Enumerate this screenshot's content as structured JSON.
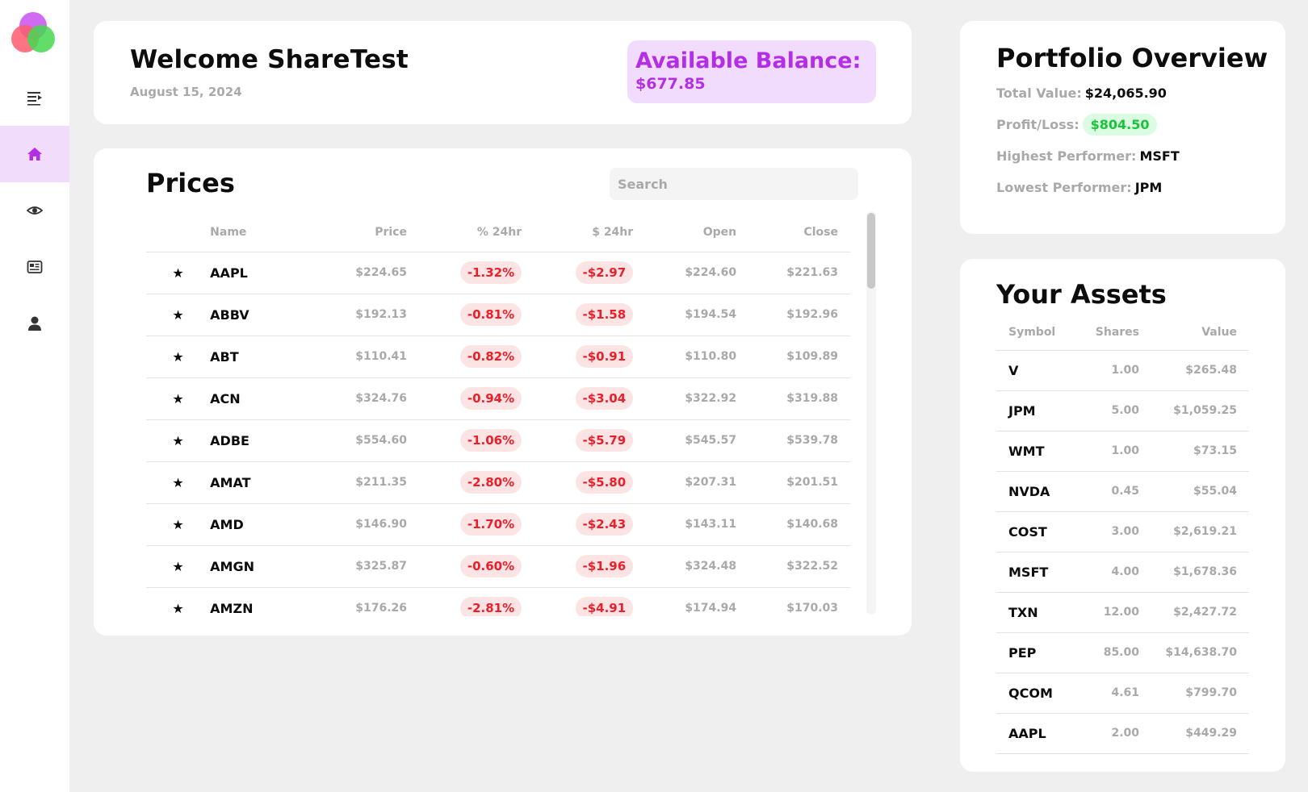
{
  "colors": {
    "accent": "#b42ee8",
    "accent_bg": "#f2dcfd",
    "negative": "#ea1f2a",
    "negative_bg": "#fde4e4",
    "positive": "#1ac43a",
    "positive_bg": "#dcfbe3"
  },
  "sidebar": {
    "items": [
      {
        "icon": "menu-icon",
        "active": false
      },
      {
        "icon": "home-icon",
        "active": true
      },
      {
        "icon": "eye-icon",
        "active": false
      },
      {
        "icon": "news-icon",
        "active": false
      },
      {
        "icon": "user-icon",
        "active": false
      }
    ]
  },
  "welcome": {
    "title": "Welcome ShareTest",
    "date": "August 15, 2024",
    "balance_label": "Available Balance:",
    "balance_value": "$677.85"
  },
  "prices": {
    "title": "Prices",
    "search_placeholder": "Search",
    "columns": [
      "Name",
      "Price",
      "% 24hr",
      "$ 24hr",
      "Open",
      "Close"
    ],
    "rows": [
      {
        "star": "★",
        "name": "AAPL",
        "price": "$224.65",
        "pct": "-1.32%",
        "chg": "-$2.97",
        "open": "$224.60",
        "close": "$221.63"
      },
      {
        "star": "★",
        "name": "ABBV",
        "price": "$192.13",
        "pct": "-0.81%",
        "chg": "-$1.58",
        "open": "$194.54",
        "close": "$192.96"
      },
      {
        "star": "★",
        "name": "ABT",
        "price": "$110.41",
        "pct": "-0.82%",
        "chg": "-$0.91",
        "open": "$110.80",
        "close": "$109.89"
      },
      {
        "star": "★",
        "name": "ACN",
        "price": "$324.76",
        "pct": "-0.94%",
        "chg": "-$3.04",
        "open": "$322.92",
        "close": "$319.88"
      },
      {
        "star": "★",
        "name": "ADBE",
        "price": "$554.60",
        "pct": "-1.06%",
        "chg": "-$5.79",
        "open": "$545.57",
        "close": "$539.78"
      },
      {
        "star": "★",
        "name": "AMAT",
        "price": "$211.35",
        "pct": "-2.80%",
        "chg": "-$5.80",
        "open": "$207.31",
        "close": "$201.51"
      },
      {
        "star": "★",
        "name": "AMD",
        "price": "$146.90",
        "pct": "-1.70%",
        "chg": "-$2.43",
        "open": "$143.11",
        "close": "$140.68"
      },
      {
        "star": "★",
        "name": "AMGN",
        "price": "$325.87",
        "pct": "-0.60%",
        "chg": "-$1.96",
        "open": "$324.48",
        "close": "$322.52"
      },
      {
        "star": "★",
        "name": "AMZN",
        "price": "$176.26",
        "pct": "-2.81%",
        "chg": "-$4.91",
        "open": "$174.94",
        "close": "$170.03"
      }
    ]
  },
  "portfolio": {
    "title": "Portfolio Overview",
    "total_label": "Total Value:",
    "total_value": "$24,065.90",
    "pl_label": "Profit/Loss:",
    "pl_value": "$804.50",
    "high_label": "Highest Performer:",
    "high_value": "MSFT",
    "low_label": "Lowest Performer:",
    "low_value": "JPM"
  },
  "assets": {
    "title": "Your Assets",
    "columns": [
      "Symbol",
      "Shares",
      "Value"
    ],
    "rows": [
      {
        "symbol": "V",
        "shares": "1.00",
        "value": "$265.48"
      },
      {
        "symbol": "JPM",
        "shares": "5.00",
        "value": "$1,059.25"
      },
      {
        "symbol": "WMT",
        "shares": "1.00",
        "value": "$73.15"
      },
      {
        "symbol": "NVDA",
        "shares": "0.45",
        "value": "$55.04"
      },
      {
        "symbol": "COST",
        "shares": "3.00",
        "value": "$2,619.21"
      },
      {
        "symbol": "MSFT",
        "shares": "4.00",
        "value": "$1,678.36"
      },
      {
        "symbol": "TXN",
        "shares": "12.00",
        "value": "$2,427.72"
      },
      {
        "symbol": "PEP",
        "shares": "85.00",
        "value": "$14,638.70"
      },
      {
        "symbol": "QCOM",
        "shares": "4.61",
        "value": "$799.70"
      },
      {
        "symbol": "AAPL",
        "shares": "2.00",
        "value": "$449.29"
      }
    ]
  }
}
